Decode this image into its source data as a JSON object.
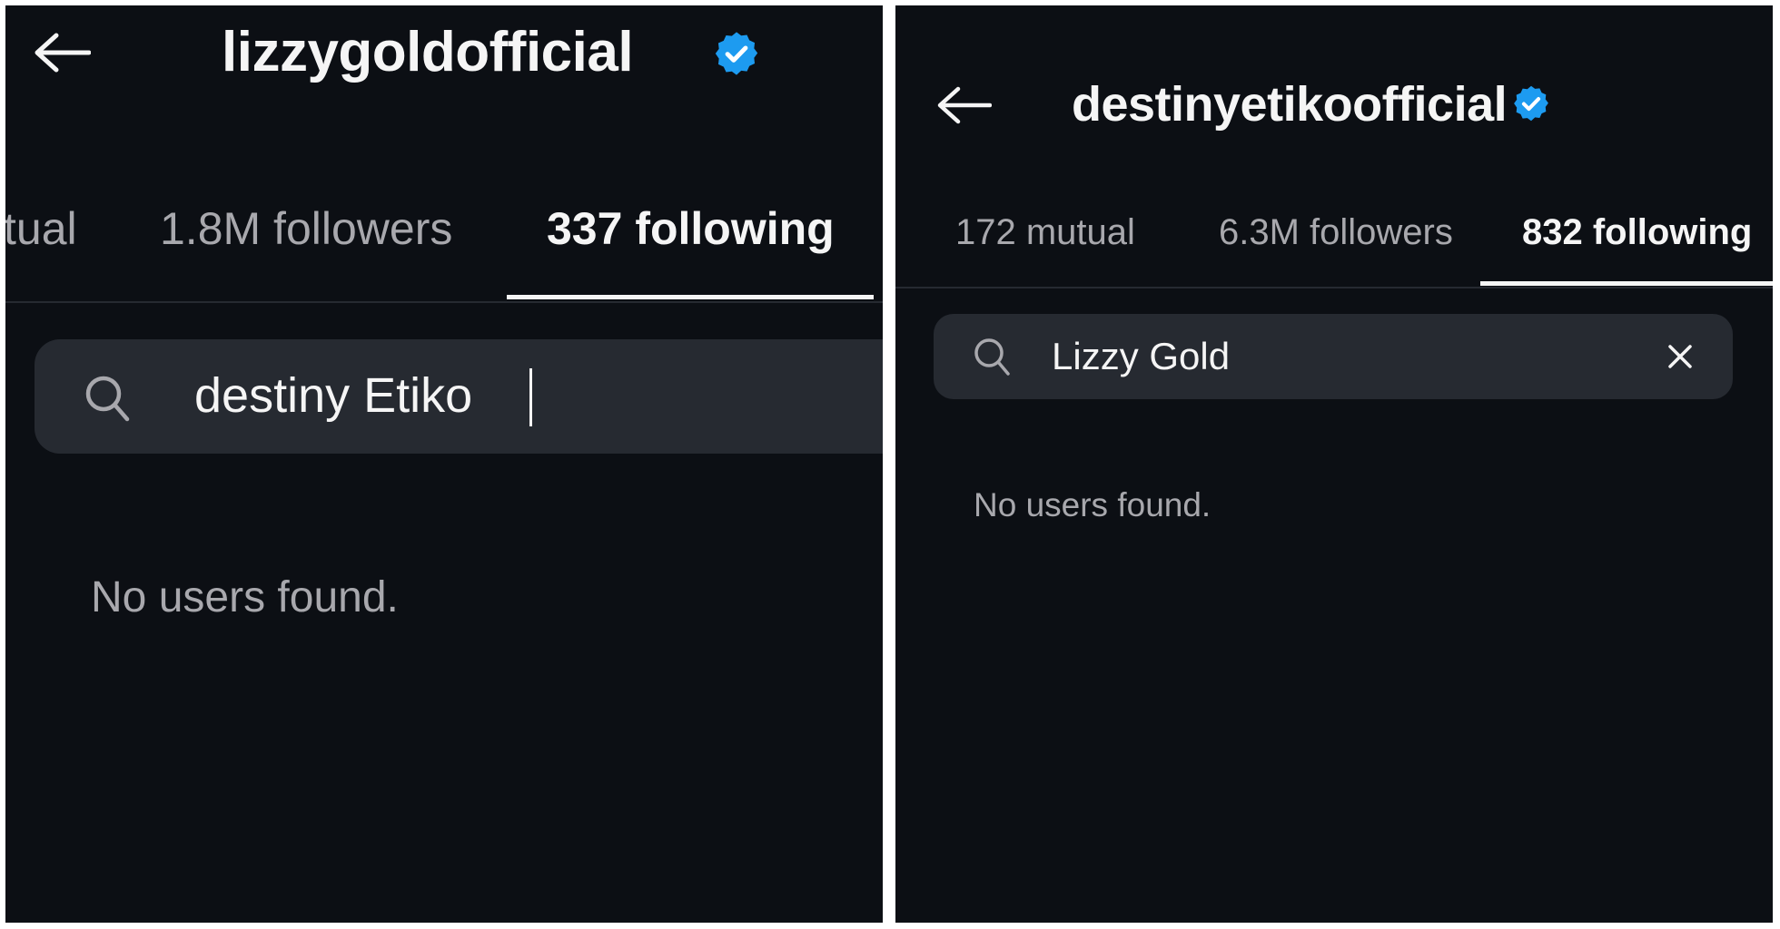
{
  "left": {
    "username": "lizzygoldofficial",
    "verified_icon": "verified-badge-icon",
    "back_icon": "arrow-left-icon",
    "tabs": [
      {
        "label": "tual",
        "active": false
      },
      {
        "label": "1.8M followers",
        "active": false
      },
      {
        "label": "337 following",
        "active": true
      }
    ],
    "search": {
      "icon": "search-icon",
      "value": "destiny Etiko",
      "placeholder": ""
    },
    "empty_message": "No users found."
  },
  "right": {
    "username": "destinyetikoofficial",
    "verified_icon": "verified-badge-icon",
    "back_icon": "arrow-left-icon",
    "tabs": [
      {
        "label": "172 mutual",
        "active": false
      },
      {
        "label": "6.3M followers",
        "active": false
      },
      {
        "label": "832 following",
        "active": true
      }
    ],
    "search": {
      "icon": "search-icon",
      "value": "Lizzy Gold",
      "placeholder": "",
      "clear_icon": "close-icon"
    },
    "empty_message": "No users found."
  },
  "colors": {
    "background": "#0c0f14",
    "search_field": "#262a31",
    "text_primary": "#f5f5f5",
    "text_secondary": "#a8a8ad",
    "verified_blue": "#1d9bf0",
    "separator": "#ffffff"
  }
}
